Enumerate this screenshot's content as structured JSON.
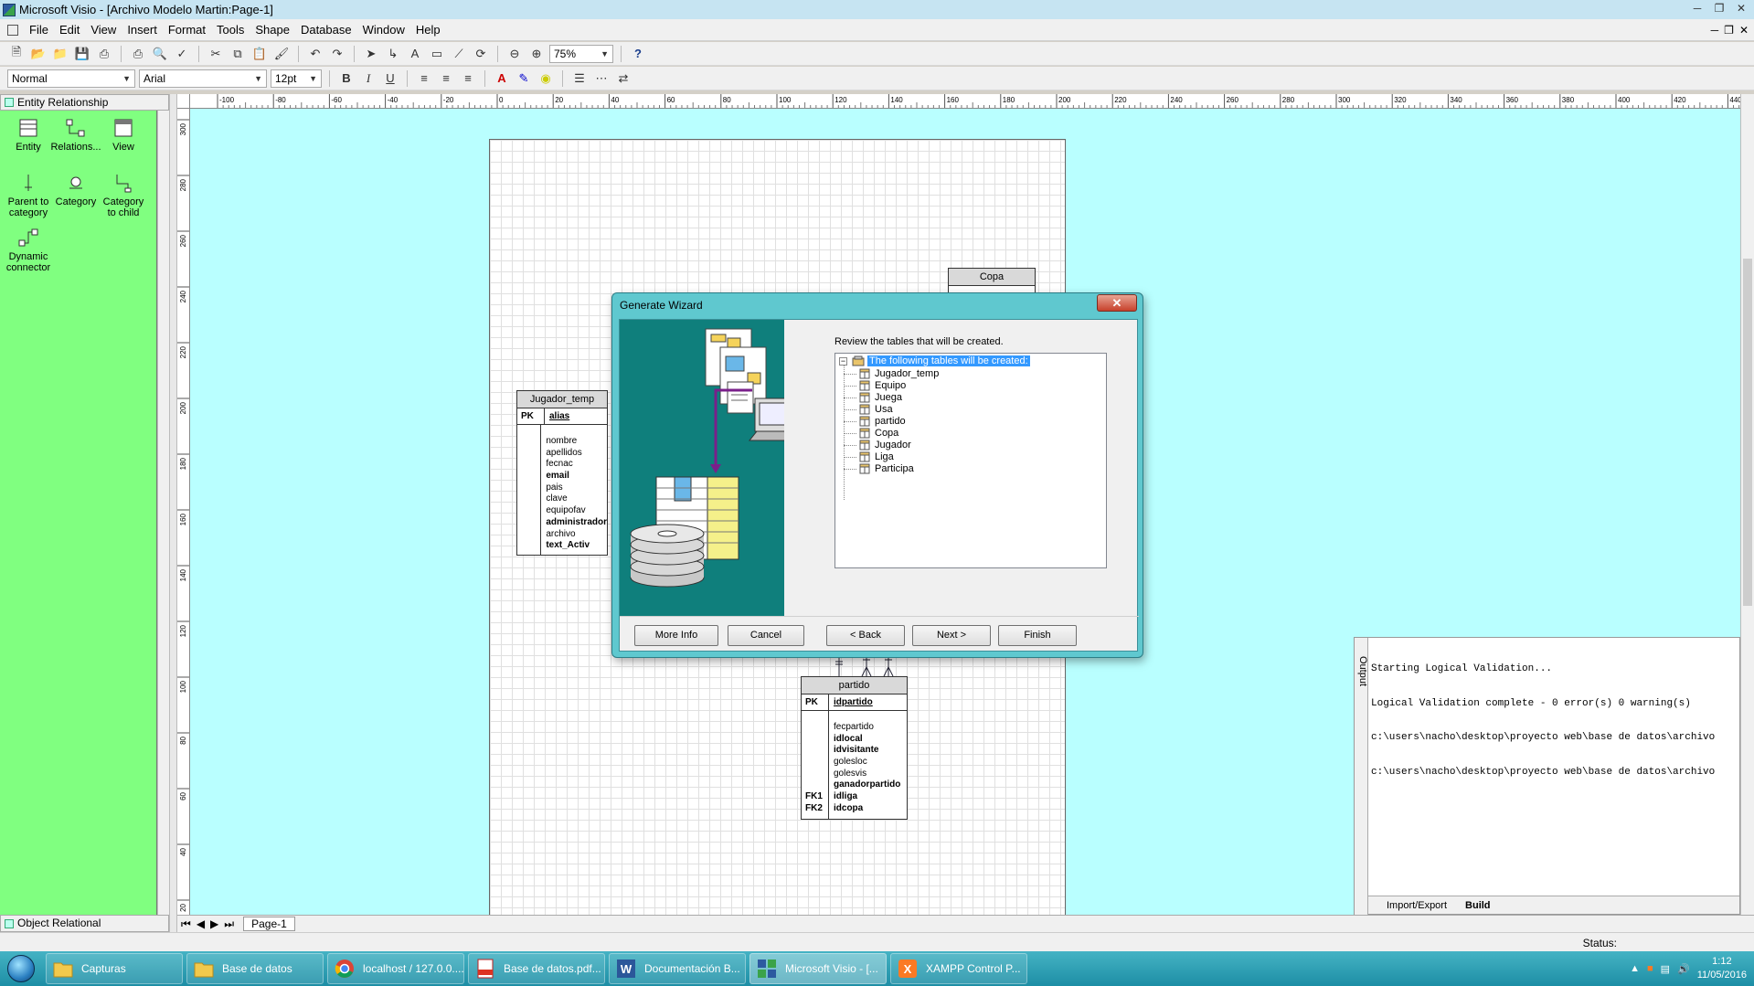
{
  "window": {
    "title": "Microsoft Visio - [Archivo Modelo Martin:Page-1]"
  },
  "menu": [
    "File",
    "Edit",
    "View",
    "Insert",
    "Format",
    "Tools",
    "Shape",
    "Database",
    "Window",
    "Help"
  ],
  "format_toolbar": {
    "style": "Normal",
    "font": "Arial",
    "size": "12pt"
  },
  "standard_toolbar": {
    "zoom": "75%"
  },
  "stencil": {
    "title": "Entity Relationship",
    "shapes": [
      {
        "label": "Entity",
        "icon": "entity-shape-icon"
      },
      {
        "label": "Relations...",
        "icon": "relationship-shape-icon"
      },
      {
        "label": "View",
        "icon": "view-shape-icon"
      },
      {
        "label": "Parent to category",
        "icon": "parent-to-category-icon"
      },
      {
        "label": "Category",
        "icon": "category-shape-icon"
      },
      {
        "label": "Category to child",
        "icon": "category-to-child-icon"
      },
      {
        "label": "Dynamic connector",
        "icon": "dynamic-connector-icon"
      }
    ],
    "footer": "Object Relational"
  },
  "ruler": {
    "top": [
      "-100",
      "-80",
      "-60",
      "-40",
      "-20",
      "0",
      "20",
      "40",
      "60",
      "80",
      "100",
      "120",
      "140",
      "160",
      "180",
      "200",
      "220",
      "240",
      "260",
      "280",
      "300",
      "320",
      "340",
      "360",
      "380",
      "400",
      "420",
      "440"
    ],
    "left": [
      "300",
      "280",
      "260",
      "240",
      "220",
      "200",
      "180",
      "160",
      "140",
      "120",
      "100",
      "80",
      "60",
      "40",
      "20"
    ]
  },
  "entities": {
    "jugador_temp": {
      "name": "Jugador_temp",
      "pk_label": "PK",
      "pk": "alias",
      "attributes": [
        {
          "name": "nombre",
          "bold": false
        },
        {
          "name": "apellidos",
          "bold": false
        },
        {
          "name": "fecnac",
          "bold": false
        },
        {
          "name": "email",
          "bold": true
        },
        {
          "name": "pais",
          "bold": false
        },
        {
          "name": "clave",
          "bold": false
        },
        {
          "name": "equipofav",
          "bold": false
        },
        {
          "name": "administrador",
          "bold": true
        },
        {
          "name": "archivo",
          "bold": false
        },
        {
          "name": "text_Activ",
          "bold": true
        }
      ]
    },
    "copa": {
      "name": "Copa"
    },
    "partido": {
      "name": "partido",
      "pk_label": "PK",
      "pk": "idpartido",
      "attributes": [
        {
          "name": "fecpartido",
          "bold": false,
          "fk": ""
        },
        {
          "name": "idlocal",
          "bold": true,
          "fk": ""
        },
        {
          "name": "idvisitante",
          "bold": true,
          "fk": ""
        },
        {
          "name": "golesloc",
          "bold": false,
          "fk": ""
        },
        {
          "name": "golesvis",
          "bold": false,
          "fk": ""
        },
        {
          "name": "ganadorpartido",
          "bold": true,
          "fk": ""
        },
        {
          "name": "idliga",
          "bold": true,
          "fk": "FK1"
        },
        {
          "name": "idcopa",
          "bold": true,
          "fk": "FK2"
        }
      ]
    }
  },
  "output": {
    "tab_label": "Output",
    "lines": [
      "Starting Logical Validation...",
      "Logical Validation complete - 0 error(s) 0 warning(s)",
      "c:\\users\\nacho\\desktop\\proyecto web\\base de datos\\archivo",
      "c:\\users\\nacho\\desktop\\proyecto web\\base de datos\\archivo"
    ],
    "tabs": [
      "Import/Export",
      "Build"
    ],
    "active_tab": "Build"
  },
  "page_tab": "Page-1",
  "status": {
    "label": "Status:"
  },
  "dialog": {
    "title": "Generate Wizard",
    "prompt": "Review the tables that will be created.",
    "root_label": "The following tables will be created:",
    "tables": [
      "Jugador_temp",
      "Equipo",
      "Juega",
      "Usa",
      "partido",
      "Copa",
      "Jugador",
      "Liga",
      "Participa"
    ],
    "buttons": {
      "more_info": "More Info",
      "cancel": "Cancel",
      "back": "< Back",
      "next": "Next >",
      "finish": "Finish"
    }
  },
  "taskbar": {
    "items": [
      {
        "label": "Capturas",
        "icon": "folder-icon"
      },
      {
        "label": "Base de datos",
        "icon": "folder-icon"
      },
      {
        "label": "localhost / 127.0.0....",
        "icon": "chrome-icon"
      },
      {
        "label": "Base de datos.pdf...",
        "icon": "pdf-icon"
      },
      {
        "label": "Documentación B...",
        "icon": "word-icon"
      },
      {
        "label": "Microsoft Visio - [...",
        "icon": "visio-icon"
      },
      {
        "label": "XAMPP Control P...",
        "icon": "xampp-icon"
      }
    ],
    "time": "1:12",
    "date": "11/05/2016"
  },
  "colors": {
    "canvas_bg": "#b9ffff",
    "stencil_bg": "#80ff80",
    "dialog_frame": "#5fc8cf",
    "dialog_art": "#0f7f7c",
    "selection": "#3399ff"
  }
}
